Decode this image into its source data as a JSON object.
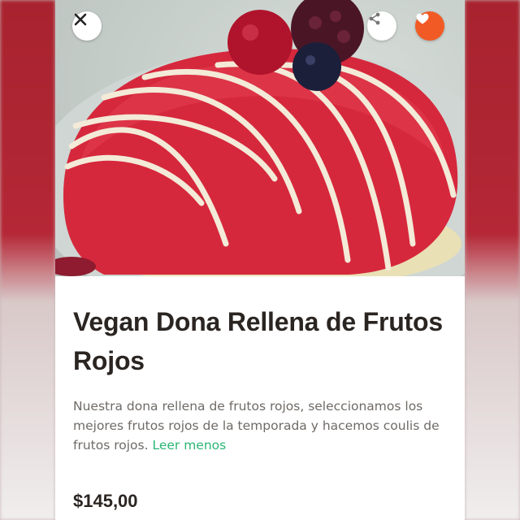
{
  "product": {
    "title": "Vegan Dona Rellena de Frutos Rojos",
    "description": "Nuestra dona rellena de frutos rojos, seleccionamos los mejores frutos rojos de la temporada y hacemos coulis de frutos rojos.",
    "read_less_label": "Leer menos",
    "price": "$145,00"
  },
  "icons": {
    "close": "close-icon",
    "share": "share-icon",
    "favorite": "heart-icon"
  },
  "colors": {
    "accent_green": "#2bb673",
    "favorite_orange": "#f15a24",
    "glaze_red": "#d6283c"
  }
}
